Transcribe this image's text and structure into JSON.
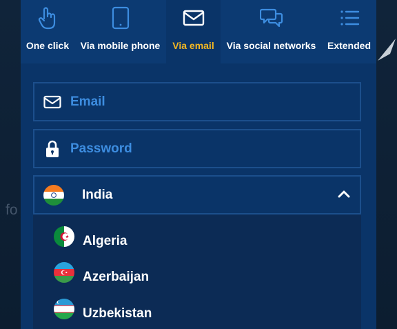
{
  "background": {
    "partial_text": "fo"
  },
  "tabs": [
    {
      "label": "One click",
      "icon": "hand-pointer-icon",
      "active": false
    },
    {
      "label": "Via mobile phone",
      "icon": "mobile-phone-icon",
      "active": false
    },
    {
      "label": "Via email",
      "icon": "envelope-icon",
      "active": true
    },
    {
      "label": "Via social networks",
      "icon": "chat-bubbles-icon",
      "active": false
    },
    {
      "label": "Extended",
      "icon": "list-icon",
      "active": false
    }
  ],
  "form": {
    "email_placeholder": "Email",
    "password_placeholder": "Password",
    "country_selected": "India",
    "country_options": [
      "Algeria",
      "Azerbaijan",
      "Uzbekistan"
    ]
  },
  "colors": {
    "panel": "#0a3468",
    "tab_bar": "#0c3a72",
    "active_tab_text": "#f5b822",
    "placeholder_text": "#3d8de0",
    "field_border": "#1c4f8c",
    "dropdown_bg": "#0c2b55"
  }
}
